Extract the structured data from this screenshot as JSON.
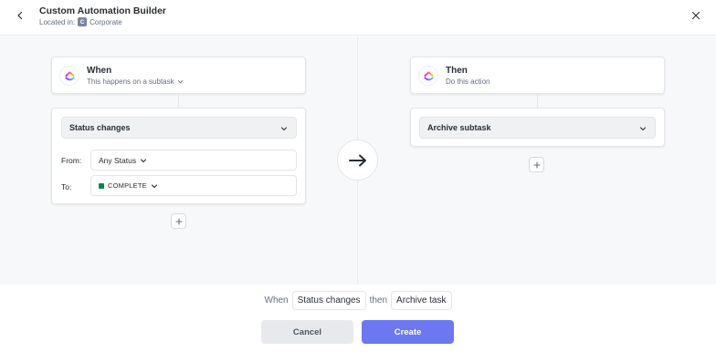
{
  "header": {
    "title": "Custom Automation Builder",
    "located_label": "Located in:",
    "space_badge": "C",
    "space_name": "Corporate"
  },
  "trigger": {
    "title": "When",
    "subtitle": "This happens on a subtask",
    "event_select": "Status changes",
    "from_label": "From:",
    "from_value": "Any Status",
    "to_label": "To:",
    "to_value": "COMPLETE",
    "to_color": "#008844"
  },
  "action": {
    "title": "Then",
    "subtitle": "Do this action",
    "action_select": "Archive subtask"
  },
  "summary": {
    "when": "When",
    "trigger": "Status changes",
    "then": "then",
    "action": "Archive task"
  },
  "buttons": {
    "cancel": "Cancel",
    "create": "Create"
  },
  "colors": {
    "accent": "#6d77f0",
    "status_complete": "#008844"
  },
  "icons": [
    "back-arrow-icon",
    "close-icon",
    "clickup-logo-icon",
    "chevron-down-icon",
    "plus-icon",
    "right-arrow-icon"
  ]
}
